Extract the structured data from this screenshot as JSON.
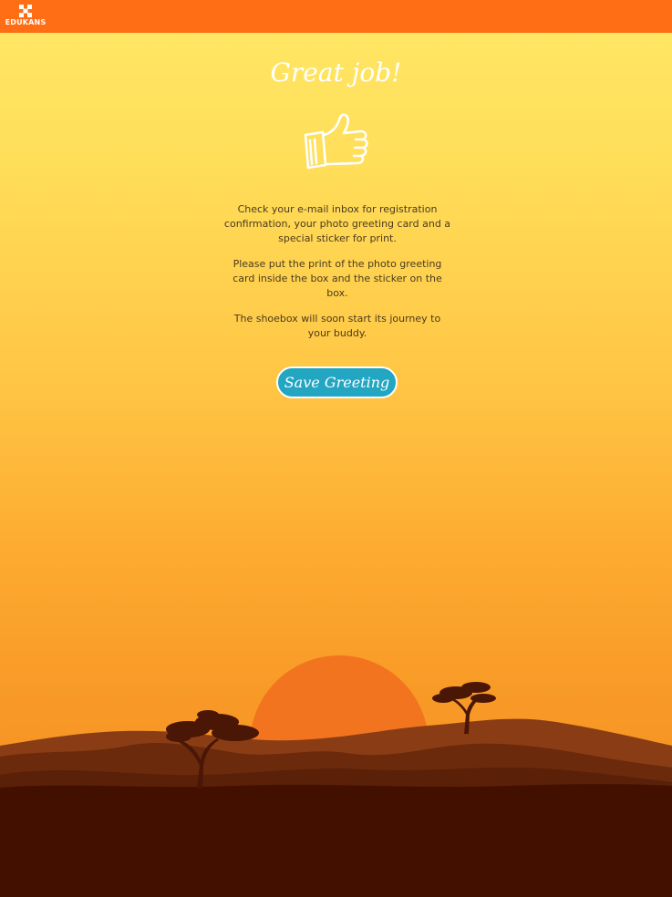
{
  "header": {
    "logo_text": "EDUKANS",
    "bar_color": "#ff6e14"
  },
  "main": {
    "headline": "Great job!",
    "icon": "thumbs-up-icon",
    "paragraphs": [
      "Check your e-mail inbox for registration confirmation, your photo greeting card and a special sticker for print.",
      "Please put the print of the photo greeting card inside the box and the sticker on the box.",
      "The shoebox will soon start its journey to your buddy."
    ],
    "save_button_label": "Save Greeting",
    "button_color": "#23a6c2"
  },
  "scene": {
    "illustration": "savanna-sunset-illustration",
    "sun_color": "#f2741f",
    "ground_color": "#431000"
  }
}
